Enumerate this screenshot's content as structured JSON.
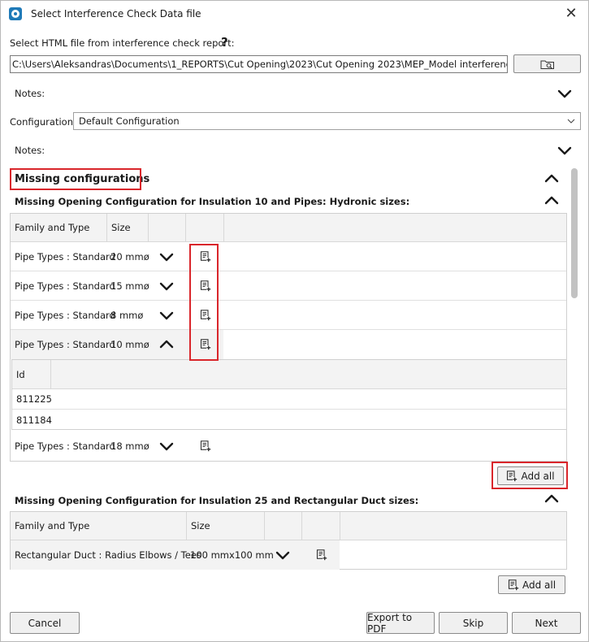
{
  "window": {
    "title": "Select Interference Check Data file"
  },
  "file": {
    "label": "Select HTML file from interference check report:",
    "help": "?",
    "path": "C:\\Users\\Aleksandras\\Documents\\1_REPORTS\\Cut Opening\\2023\\Cut Opening 2023\\MEP_Model interference.html"
  },
  "notes1": {
    "label": "Notes:"
  },
  "configuration": {
    "label": "Configuration",
    "selected": "Default Configuration"
  },
  "notes2": {
    "label": "Notes:"
  },
  "missing": {
    "heading": "Missing configurations",
    "section1": {
      "title": "Missing Opening Configuration for Insulation 10 and Pipes: Hydronic sizes:",
      "headers": {
        "family": "Family and Type",
        "size": "Size"
      },
      "rows": [
        {
          "family": "Pipe Types : Standard",
          "size": "20 mmø"
        },
        {
          "family": "Pipe Types : Standard",
          "size": "15 mmø"
        },
        {
          "family": "Pipe Types : Standard",
          "size": "8 mmø"
        },
        {
          "family": "Pipe Types : Standard",
          "size": "10 mmø"
        },
        {
          "family": "Pipe Types : Standard",
          "size": "18 mmø"
        }
      ],
      "detail": {
        "header": "Id",
        "ids": [
          "811225",
          "811184"
        ]
      },
      "add_all": "Add all"
    },
    "section2": {
      "title": "Missing Opening Configuration for Insulation 25 and Rectangular Duct sizes:",
      "headers": {
        "family": "Family and Type",
        "size": "Size"
      },
      "rows": [
        {
          "family": "Rectangular Duct : Radius Elbows / Tees",
          "size": "100 mmx100 mm"
        }
      ],
      "add_all": "Add all"
    }
  },
  "footer": {
    "cancel": "Cancel",
    "export": "Export to PDF",
    "skip": "Skip",
    "next": "Next"
  },
  "colors": {
    "highlight": "#d9262b",
    "accent": "#1f7ab8"
  }
}
